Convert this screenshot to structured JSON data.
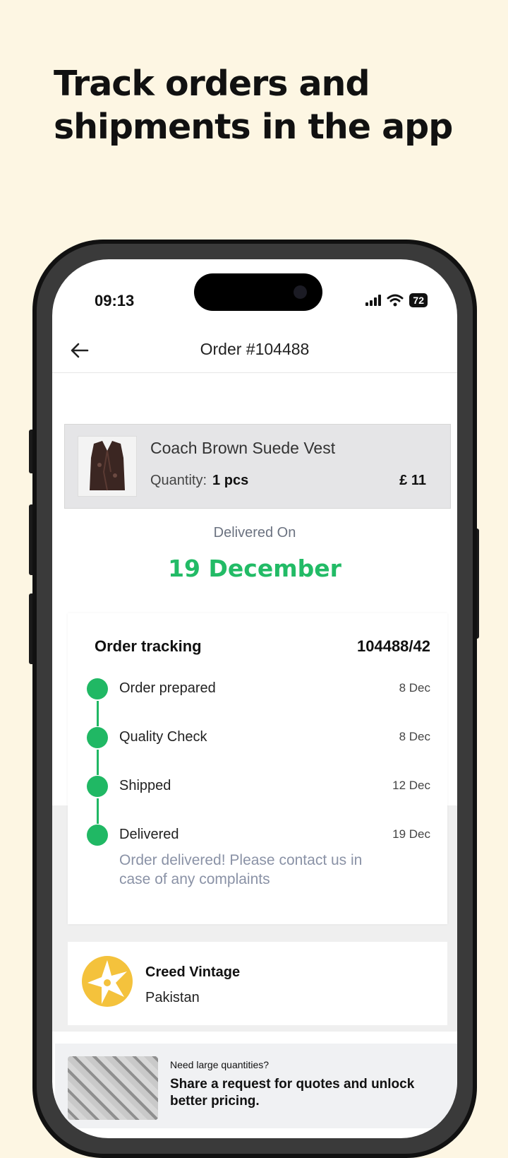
{
  "headline": {
    "line1": "Track orders and",
    "line2": "shipments in the app"
  },
  "status_bar": {
    "time": "09:13",
    "battery": "72"
  },
  "app_bar": {
    "back_icon": "arrow-left-icon",
    "title": "Order #104488"
  },
  "product": {
    "name": "Coach Brown Suede Vest",
    "quantity_label": "Quantity:",
    "quantity_value": "1 pcs",
    "price": "£ 11"
  },
  "delivery": {
    "label": "Delivered On",
    "date": "19 December",
    "color": "#22bb66"
  },
  "tracking": {
    "title": "Order tracking",
    "tracking_id": "104488/42",
    "steps": [
      {
        "label": "Order prepared",
        "date": "8 Dec"
      },
      {
        "label": "Quality Check",
        "date": "8 Dec"
      },
      {
        "label": "Shipped",
        "date": "12 Dec"
      },
      {
        "label": "Delivered",
        "date": "19 Dec"
      }
    ],
    "note": "Order delivered! Please contact us in case of any complaints"
  },
  "seller": {
    "name": "Creed Vintage",
    "country": "Pakistan",
    "logo_icon": "star-badge-icon"
  },
  "promo": {
    "small": "Need large quantities?",
    "big": "Share a request for quotes and unlock better pricing."
  }
}
